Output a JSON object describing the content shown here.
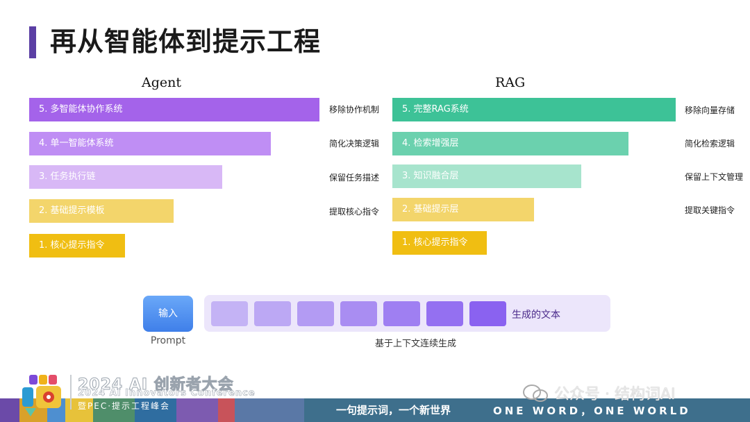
{
  "page": {
    "title": "再从智能体到提示工程"
  },
  "agent": {
    "heading": "Agent",
    "bars": [
      {
        "label": "5. 多智能体协作系统",
        "note": "移除协作机制",
        "color": "#a463ea"
      },
      {
        "label": "4. 单一智能体系统",
        "note": "简化决策逻辑",
        "color": "#bf8ef4"
      },
      {
        "label": "3. 任务执行链",
        "note": "保留任务描述",
        "color": "#d8b8f6"
      },
      {
        "label": "2. 基础提示模板",
        "note": "提取核心指令",
        "color": "#f3d56b"
      },
      {
        "label": "1. 核心提示指令",
        "note": "",
        "color": "#f0be12"
      }
    ]
  },
  "rag": {
    "heading": "RAG",
    "bars": [
      {
        "label": "5. 完整RAG系统",
        "note": "移除向量存储",
        "color": "#3dc297"
      },
      {
        "label": "4. 检索增强层",
        "note": "简化检索逻辑",
        "color": "#6bd1ae"
      },
      {
        "label": "3. 知识融合层",
        "note": "保留上下文管理",
        "color": "#a7e4cd"
      },
      {
        "label": "2. 基础提示层",
        "note": "提取关键指令",
        "color": "#f3d56b"
      },
      {
        "label": "1. 核心提示指令",
        "note": "",
        "color": "#f0be12"
      }
    ]
  },
  "flow": {
    "input_label": "输入",
    "prompt_label": "Prompt",
    "generated_label": "生成的文本",
    "context_label": "基于上下文连续生成",
    "token_colors": [
      "#c4b3f5",
      "#bca8f4",
      "#b39bf3",
      "#a98df2",
      "#9f7ff2",
      "#9470f1",
      "#8a62f0"
    ]
  },
  "footer": {
    "conference_title": "2024 AI 创新者大会",
    "conference_en": "2024 AI Innovators Conference",
    "conference_sub": "暨PEC·提示工程峰会",
    "slogan": "一句提示词，一个新世界",
    "slogan_en": "ONE WORD，ONE WORLD",
    "watermark": "公众号 · 结构词AI"
  }
}
